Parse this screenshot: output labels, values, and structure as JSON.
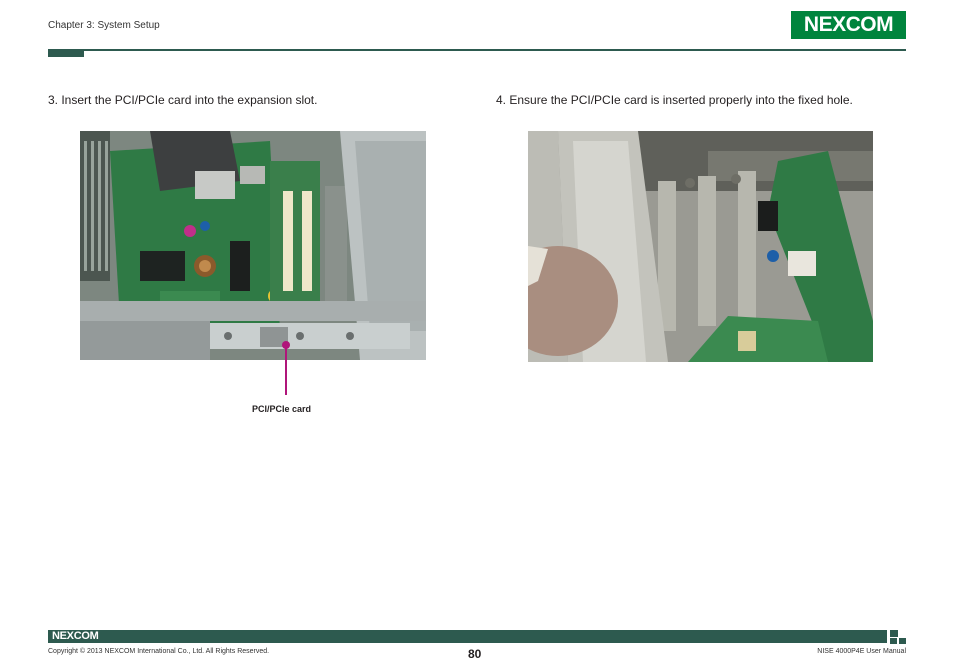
{
  "header": {
    "chapter": "Chapter 3: System Setup",
    "logo": "NEXCOM"
  },
  "steps": [
    {
      "text": "3. Insert the PCI/PCIe card into the expansion slot."
    },
    {
      "text": "4. Ensure the PCI/PCIe card is inserted properly into the fixed hole."
    }
  ],
  "callout": {
    "label": "PCI/PCIe card",
    "color": "#b0157a"
  },
  "footer": {
    "logo": "NEXCOM",
    "copyright": "Copyright © 2013 NEXCOM International Co., Ltd. All Rights Reserved.",
    "page_number": "80",
    "manual_name": "NISE 4000P4E User Manual"
  },
  "colors": {
    "accent": "#2d5a4f",
    "logo_green": "#00843d"
  }
}
